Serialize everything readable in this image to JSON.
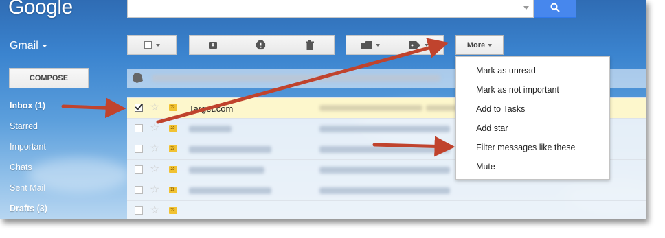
{
  "header": {
    "logo": "Google"
  },
  "app": {
    "label": "Gmail"
  },
  "search": {
    "placeholder": ""
  },
  "toolbar": {
    "more_label": "More"
  },
  "sidebar": {
    "compose_label": "COMPOSE",
    "items": [
      {
        "label": "Inbox (1)",
        "bold": true
      },
      {
        "label": "Starred",
        "bold": false
      },
      {
        "label": "Important",
        "bold": false
      },
      {
        "label": "Chats",
        "bold": false
      },
      {
        "label": "Sent Mail",
        "bold": false
      },
      {
        "label": "Drafts (3)",
        "bold": true
      }
    ]
  },
  "messages": [
    {
      "sender": "Target.com",
      "snippet": "Welcome to Target.com",
      "selected": true
    },
    {
      "sender": "",
      "selected": false
    },
    {
      "sender": "",
      "selected": false
    },
    {
      "sender": "",
      "selected": false
    }
  ],
  "more_menu": {
    "items": [
      "Mark as unread",
      "Mark as not important",
      "Add to Tasks",
      "Add star",
      "Filter messages like these",
      "Mute"
    ]
  },
  "colors": {
    "accent_blue": "#4787ed",
    "annotation_arrow": "#c0432d",
    "selected_row": "#fdf7cc",
    "important_marker": "#f1c232"
  }
}
